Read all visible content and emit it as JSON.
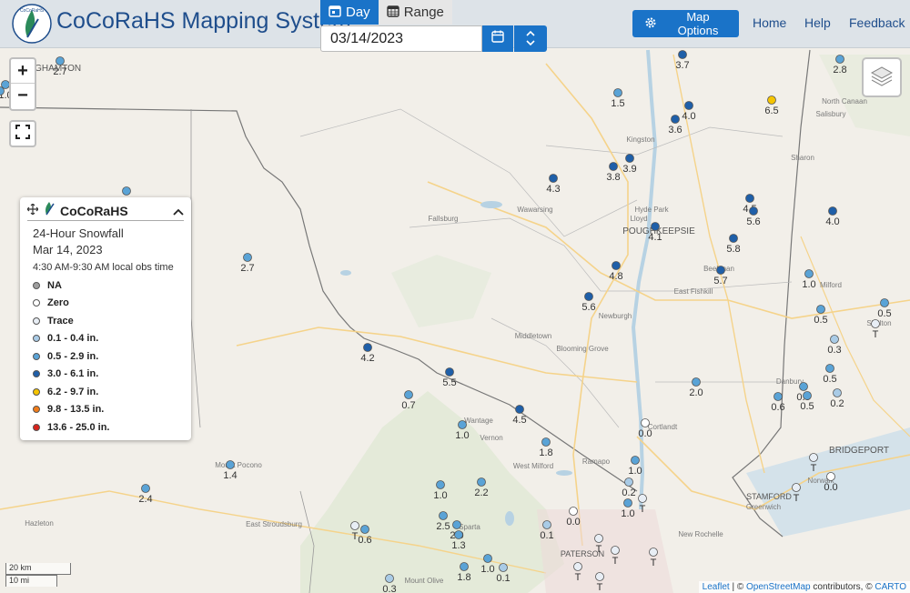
{
  "header": {
    "title": "CoCoRaHS Mapping System",
    "logo_text": "CoCoRaHS",
    "tab_day": "Day",
    "tab_range": "Range",
    "date_value": "03/14/2023",
    "map_options": "Map Options",
    "nav_home": "Home",
    "nav_help": "Help",
    "nav_feedback": "Feedback"
  },
  "zoom": {
    "in": "+",
    "out": "−"
  },
  "legend": {
    "brand": "CoCoRaHS",
    "product": "24-Hour Snowfall",
    "date": "Mar 14, 2023",
    "obs_time": "4:30 AM-9:30 AM local obs time",
    "items": [
      {
        "label": "NA",
        "color": "#9e9e9e"
      },
      {
        "label": "Zero",
        "color": "#ffffff"
      },
      {
        "label": "Trace",
        "color": "#e8eef5"
      },
      {
        "label": "0.1 - 0.4 in.",
        "color": "#a9cbe6"
      },
      {
        "label": "0.5 - 2.9 in.",
        "color": "#5aa3d6"
      },
      {
        "label": "3.0 - 6.1 in.",
        "color": "#1f5fa8"
      },
      {
        "label": "6.2 - 9.7 in.",
        "color": "#f5c400"
      },
      {
        "label": "9.8 - 13.5 in.",
        "color": "#f07c1a"
      },
      {
        "label": "13.6 - 25.0 in.",
        "color": "#d8231c"
      }
    ]
  },
  "scale": {
    "km": "20 km",
    "mi": "10 mi"
  },
  "attribution": {
    "leaflet": "Leaflet",
    "sep": " | © ",
    "osm": "OpenStreetMap",
    "contrib": " contributors, © ",
    "carto": "CARTO"
  },
  "place_labels": [
    {
      "text": "NGHAMTON"
    },
    {
      "text": "Kingston"
    },
    {
      "text": "Hyde Park"
    },
    {
      "text": "Lloyd"
    },
    {
      "text": "POUGHKEEPSIE"
    },
    {
      "text": "Beekman"
    },
    {
      "text": "East Fishkill"
    },
    {
      "text": "Newburgh"
    },
    {
      "text": "Fallsburg"
    },
    {
      "text": "Wawarsing"
    },
    {
      "text": "Middletown"
    },
    {
      "text": "Blooming Grove"
    },
    {
      "text": "Wantage"
    },
    {
      "text": "Vernon"
    },
    {
      "text": "West Milford"
    },
    {
      "text": "Ramapo"
    },
    {
      "text": "Cortlandt"
    },
    {
      "text": "Danbury"
    },
    {
      "text": "Milford"
    },
    {
      "text": "Shelton"
    },
    {
      "text": "BRIDGEPORT"
    },
    {
      "text": "Norwalk"
    },
    {
      "text": "STAMFORD"
    },
    {
      "text": "Greenwich"
    },
    {
      "text": "New Rochelle"
    },
    {
      "text": "PATERSON"
    },
    {
      "text": "Sparta"
    },
    {
      "text": "Mount Olive"
    },
    {
      "text": "East Stroudsburg"
    },
    {
      "text": "Mount Pocono"
    },
    {
      "text": "Hazleton"
    },
    {
      "text": "North Canaan"
    },
    {
      "text": "Salisbury"
    },
    {
      "text": "Sharon"
    }
  ],
  "stations": [
    {
      "v": "2.7",
      "c": "#5aa3d6"
    },
    {
      "v": "1.0",
      "c": "#5aa3d6"
    },
    {
      "v": "3.7",
      "c": "#1f5fa8"
    },
    {
      "v": "1.5",
      "c": "#5aa3d6"
    },
    {
      "v": "4.0",
      "c": "#1f5fa8"
    },
    {
      "v": "3.6",
      "c": "#1f5fa8"
    },
    {
      "v": "6.5",
      "c": "#f5c400"
    },
    {
      "v": "2.8",
      "c": "#5aa3d6"
    },
    {
      "v": "4.3",
      "c": "#1f5fa8"
    },
    {
      "v": "3.8",
      "c": "#1f5fa8"
    },
    {
      "v": "3.9",
      "c": "#1f5fa8"
    },
    {
      "v": "4.5",
      "c": "#1f5fa8"
    },
    {
      "v": "5.6",
      "c": "#1f5fa8"
    },
    {
      "v": "4.0",
      "c": "#1f5fa8"
    },
    {
      "v": "4.1",
      "c": "#1f5fa8"
    },
    {
      "v": "5.8",
      "c": "#1f5fa8"
    },
    {
      "v": "2.7",
      "c": "#5aa3d6"
    },
    {
      "v": "4.8",
      "c": "#1f5fa8"
    },
    {
      "v": "5.7",
      "c": "#1f5fa8"
    },
    {
      "v": "1.0",
      "c": "#5aa3d6"
    },
    {
      "v": "5.6",
      "c": "#1f5fa8"
    },
    {
      "v": "0.5",
      "c": "#5aa3d6"
    },
    {
      "v": "0.5",
      "c": "#5aa3d6"
    },
    {
      "v": "T",
      "c": "#e8eef5"
    },
    {
      "v": "0.3",
      "c": "#a9cbe6"
    },
    {
      "v": "4.2",
      "c": "#1f5fa8"
    },
    {
      "v": "5.5",
      "c": "#1f5fa8"
    },
    {
      "v": "0.5",
      "c": "#5aa3d6"
    },
    {
      "v": "0.7",
      "c": "#5aa3d6"
    },
    {
      "v": "4.5",
      "c": "#1f5fa8"
    },
    {
      "v": "2.0",
      "c": "#5aa3d6"
    },
    {
      "v": "0.6",
      "c": "#5aa3d6"
    },
    {
      "v": "0.5",
      "c": "#5aa3d6"
    },
    {
      "v": "0.5",
      "c": "#5aa3d6"
    },
    {
      "v": "0.2",
      "c": "#a9cbe6"
    },
    {
      "v": "1.0",
      "c": "#5aa3d6"
    },
    {
      "v": "0.0",
      "c": "#ffffff"
    },
    {
      "v": "1.8",
      "c": "#5aa3d6"
    },
    {
      "v": "1.4",
      "c": "#5aa3d6"
    },
    {
      "v": "1.0",
      "c": "#5aa3d6"
    },
    {
      "v": "T",
      "c": "#e8eef5"
    },
    {
      "v": "0.0",
      "c": "#ffffff"
    },
    {
      "v": "2.4",
      "c": "#5aa3d6"
    },
    {
      "v": "1.0",
      "c": "#5aa3d6"
    },
    {
      "v": "2.2",
      "c": "#5aa3d6"
    },
    {
      "v": "0.2",
      "c": "#a9cbe6"
    },
    {
      "v": "T",
      "c": "#e8eef5"
    },
    {
      "v": "T",
      "c": "#e8eef5"
    },
    {
      "v": "2.5",
      "c": "#5aa3d6"
    },
    {
      "v": "2.0",
      "c": "#5aa3d6"
    },
    {
      "v": "0.0",
      "c": "#ffffff"
    },
    {
      "v": "T",
      "c": "#e8eef5"
    },
    {
      "v": "0.6",
      "c": "#5aa3d6"
    },
    {
      "v": "1.3",
      "c": "#5aa3d6"
    },
    {
      "v": "0.1",
      "c": "#a9cbe6"
    },
    {
      "v": "T",
      "c": "#e8eef5"
    },
    {
      "v": "T",
      "c": "#e8eef5"
    },
    {
      "v": "T",
      "c": "#e8eef5"
    },
    {
      "v": "1.8",
      "c": "#5aa3d6"
    },
    {
      "v": "1.0",
      "c": "#5aa3d6"
    },
    {
      "v": "0.1",
      "c": "#a9cbe6"
    },
    {
      "v": "T",
      "c": "#e8eef5"
    },
    {
      "v": "0.3",
      "c": "#a9cbe6"
    },
    {
      "v": "T",
      "c": "#e8eef5"
    },
    {
      "v": "1.0",
      "c": "#5aa3d6"
    },
    {
      "v": "",
      "c": "#5aa3d6"
    },
    {
      "v": "",
      "c": "#5aa3d6"
    }
  ]
}
